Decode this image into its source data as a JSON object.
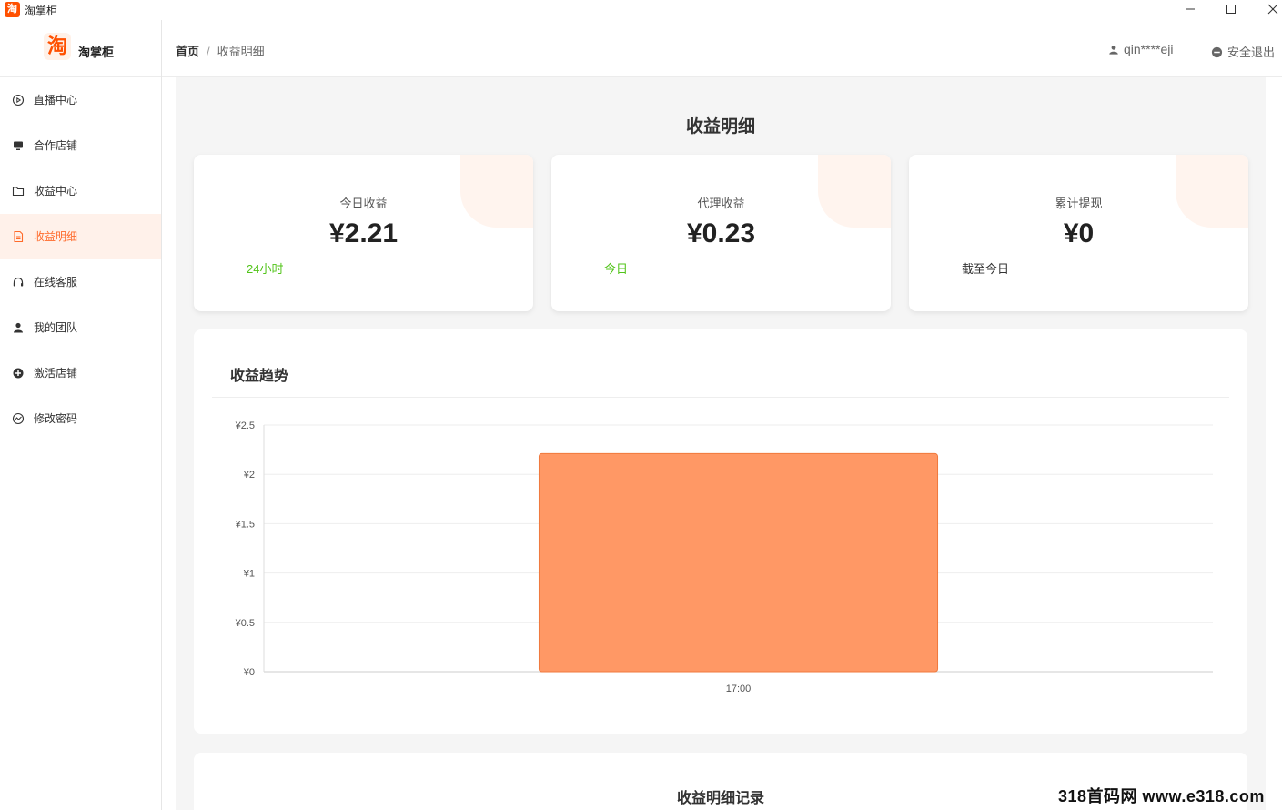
{
  "window": {
    "app_icon_text": "淘",
    "title": "淘掌柜"
  },
  "sidebar": {
    "brand_logo_text": "淘",
    "brand_name": "淘掌柜",
    "items": [
      {
        "label": "直播中心",
        "icon": "play-circle-icon"
      },
      {
        "label": "合作店铺",
        "icon": "monitor-icon"
      },
      {
        "label": "收益中心",
        "icon": "folder-icon"
      },
      {
        "label": "收益明细",
        "icon": "document-icon",
        "active": true
      },
      {
        "label": "在线客服",
        "icon": "headset-icon"
      },
      {
        "label": "我的团队",
        "icon": "user-icon"
      },
      {
        "label": "激活店铺",
        "icon": "plus-circle-icon"
      },
      {
        "label": "修改密码",
        "icon": "chart-circle-icon"
      }
    ]
  },
  "header": {
    "breadcrumb_home": "首页",
    "breadcrumb_sep": "/",
    "breadcrumb_current": "收益明细",
    "username": "qin****eji",
    "logout_label": "安全退出"
  },
  "main": {
    "page_title": "收益明细",
    "stats": [
      {
        "label": "今日收益",
        "value": "¥2.21",
        "note": "24小时"
      },
      {
        "label": "代理收益",
        "value": "¥0.23",
        "note": "今日"
      },
      {
        "label": "累计提现",
        "value": "¥0",
        "note": "截至今日"
      }
    ],
    "chart_title": "收益趋势",
    "records_title": "收益明细记录"
  },
  "colors": {
    "accent": "#ff6a2a",
    "bar": "#ff9865",
    "green": "#52c41a"
  },
  "chart_data": {
    "type": "bar",
    "categories": [
      "17:00"
    ],
    "values": [
      2.21
    ],
    "ylim": [
      0,
      2.5
    ],
    "y_ticks": [
      "¥0",
      "¥0.5",
      "¥1",
      "¥1.5",
      "¥2",
      "¥2.5"
    ],
    "title": "收益趋势",
    "grid": true
  },
  "watermark": "318首码网 www.e318.com"
}
